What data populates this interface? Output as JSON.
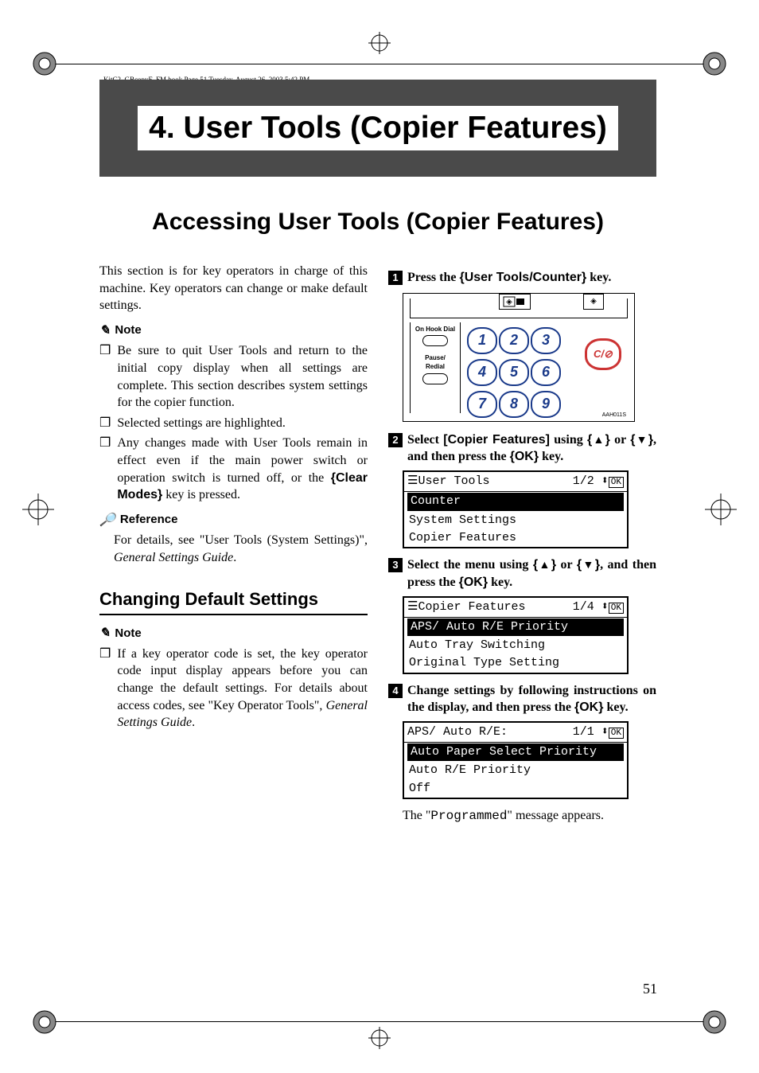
{
  "frame_header": "KitC2_GBcopyF_FM.book  Page 51  Tuesday, August 26, 2003  5:42 PM",
  "chapter_title": "4. User Tools (Copier Features)",
  "section_title": "Accessing User Tools (Copier Features)",
  "intro_para": "This section is for key operators in charge of this machine. Key operators can change or make default settings.",
  "note_label": "Note",
  "note_items": [
    "Be sure to quit User Tools and return to the initial copy display when all settings are complete. This section describes system settings for the copier function.",
    "Selected settings are highlighted.",
    "Any changes made with User Tools remain in effect even if the main power switch or operation switch is turned off, or the {Clear Modes} key is pressed."
  ],
  "clear_modes_key": "Clear Modes",
  "reference_label": "Reference",
  "reference_text_a": "For details, see \"User Tools (System Settings)\", ",
  "reference_text_b": "General Settings Guide",
  "reference_text_c": ".",
  "subsection_title": "Changing Default Settings",
  "note2_items": [
    "If a key operator code is set, the key operator code input display appears before you can change the default settings. For details about access codes, see \"Key Operator Tools\", General Settings Guide."
  ],
  "note2_text_a": "If a key operator code is set, the key operator code input display appears before you can change the default settings. For details about access codes, see \"Key Operator Tools\", ",
  "note2_text_b": "General Settings Guide",
  "note2_text_c": ".",
  "steps": {
    "s1_a": "Press the ",
    "s1_key": "User Tools/Counter",
    "s1_b": " key.",
    "s2_a": "Select ",
    "s2_menu": "[Copier Features]",
    "s2_b": " using ",
    "s2_c": " or ",
    "s2_d": ", and then press the ",
    "s2_ok": "OK",
    "s2_e": " key.",
    "s3_a": "Select the menu using ",
    "s3_b": " or ",
    "s3_c": ", and then press the ",
    "s3_ok": "OK",
    "s3_d": " key.",
    "s4_a": "Change settings by following instructions on the display, and then press the ",
    "s4_ok": "OK",
    "s4_b": " key."
  },
  "keypad": {
    "side1": "On Hook Dial",
    "side2": "Pause/\nRedial",
    "clear": "C/",
    "keys": [
      "1",
      "2",
      "3",
      "4",
      "5",
      "6",
      "7",
      "8",
      "9"
    ],
    "figid": "AAH011S"
  },
  "lcd1": {
    "title": "User Tools",
    "page": "1/2",
    "rows": [
      "Counter",
      "System Settings",
      "Copier Features"
    ],
    "selected": 0
  },
  "lcd2": {
    "title": "Copier Features",
    "page": "1/4",
    "rows": [
      "APS/ Auto R/E Priority",
      "Auto Tray Switching",
      "Original Type Setting"
    ],
    "selected": 0
  },
  "lcd3": {
    "title": "APS/ Auto R/E:",
    "page": "1/1",
    "rows": [
      "Auto Paper Select Priority",
      "Auto R/E Priority",
      "Off"
    ],
    "selected": 0
  },
  "post_text_a": "The \"",
  "post_text_b": "Programmed",
  "post_text_c": "\" message appears.",
  "page_number": "51",
  "ok_label": "OK",
  "icon_list": "☰"
}
